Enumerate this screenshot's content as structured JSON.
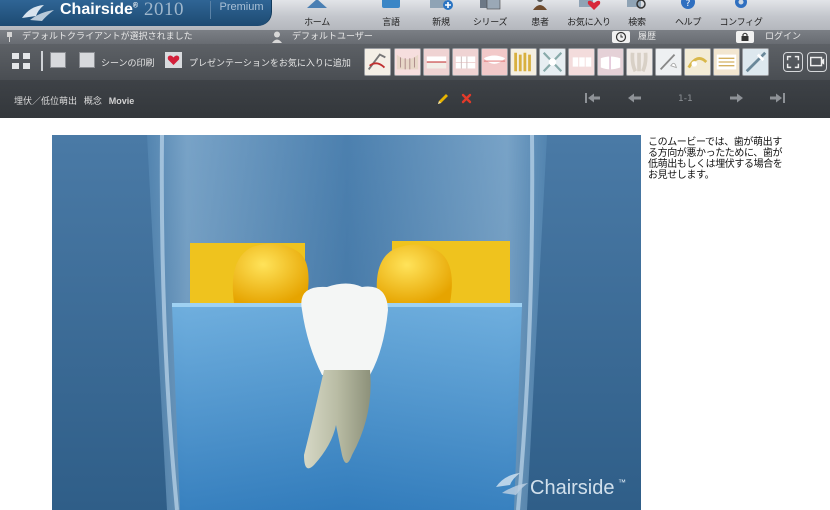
{
  "app": {
    "brand_name": "Chairside",
    "brand_mark": "®",
    "year": "2010",
    "edition": "Premium"
  },
  "nav": [
    {
      "label": "ホーム",
      "icon": "home-icon"
    },
    {
      "label": "言語",
      "icon": "language-icon"
    },
    {
      "label": "新規",
      "icon": "new-icon"
    },
    {
      "label": "シリーズ",
      "icon": "series-icon"
    },
    {
      "label": "患者",
      "icon": "patient-icon"
    },
    {
      "label": "お気に入り",
      "icon": "favorites-icon"
    },
    {
      "label": "検索",
      "icon": "search-icon"
    },
    {
      "label": "ヘルプ",
      "icon": "help-icon"
    },
    {
      "label": "コンフィグ",
      "icon": "config-icon"
    }
  ],
  "infobar": {
    "client": "デフォルトクライアントが選択されました",
    "user": "デフォルトユーザー",
    "history": "履歴",
    "login": "ログイン"
  },
  "toolbar": {
    "print_scene": "シーンの印刷",
    "add_favorite": "プレゼンテーションをお気に入りに追加"
  },
  "title": {
    "topic": "埋伏／低位萌出",
    "section": "概念",
    "type": "Movie",
    "pager": "1-1"
  },
  "movie": {
    "watermark": "Chairside",
    "watermark_mark": "™"
  },
  "description": "このムービーでは、歯が萌出する方向が悪かったために、歯が低萌出もしくは埋伏する場合をお見せします。",
  "colors": {
    "brand_blue": "#25567f",
    "toolbar_dark": "#4a4e53",
    "titlebar_dark": "#35393d",
    "movie_bg": "#3f6f99",
    "edit_pencil": "#e8b400",
    "delete_x": "#e23a2a"
  }
}
